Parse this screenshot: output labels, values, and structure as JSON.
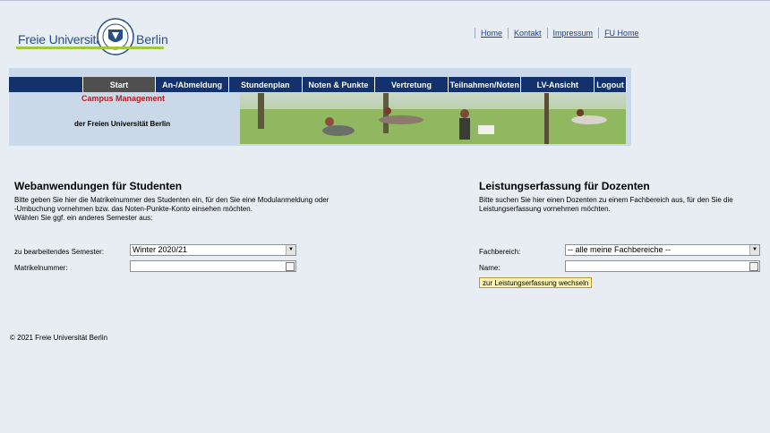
{
  "logo": {
    "left": "Freie Universität",
    "right": "Berlin"
  },
  "toplinks": [
    "Home",
    "Kontakt",
    "Impressum",
    "FU Home"
  ],
  "nav": [
    "Start",
    "An-/Abmeldung",
    "Stundenplan",
    "Noten & Punkte",
    "Vertretung",
    "Teilnahmen/Noten",
    "LV-Ansicht",
    "Logout"
  ],
  "banner": {
    "title": "Campus Management",
    "subtitle": "der Freien Universität Berlin"
  },
  "students": {
    "title": "Webanwendungen für Studenten",
    "desc1": "Bitte geben Sie hier die Matrikelnummer des Studenten ein, für den Sie eine Modulanmeldung oder",
    "desc2": "-Umbuchung vornehmen bzw. das Noten-Punkte-Konto einsehen möchten.",
    "desc3": "Wählen Sie ggf. ein anderes Semester aus:",
    "semester_label": "zu bearbeitendes Semester:",
    "semester_value": "Winter 2020/21",
    "matrikel_label": "Matrikelnummer:",
    "matrikel_value": ""
  },
  "lecturers": {
    "title": "Leistungserfassung für Dozenten",
    "desc1": "Bitte suchen Sie hier einen Dozenten zu einem Fachbereich aus, für den Sie die",
    "desc2": "Leistungserfassung vornehmen möchten.",
    "fach_label": "Fachbereich:",
    "fach_value": "-- alle meine Fachbereiche --",
    "name_label": "Name:",
    "name_value": "",
    "button": "zur Leistungserfassung wechseln"
  },
  "footer": "© 2021 Freie Universität Berlin",
  "colors": {
    "nav": "#13316a",
    "nav_active": "#4f4f4f",
    "accent_red": "#b31d1d",
    "logo_green": "#9fc83b"
  }
}
